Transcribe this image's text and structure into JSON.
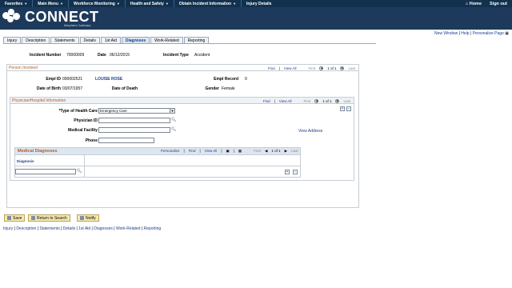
{
  "nav": {
    "items": [
      "Favorites",
      "Main Menu",
      "Workforce Monitoring",
      "Health and Safety",
      "Obtain Incident Information",
      "Injury Details"
    ],
    "home": "Home",
    "signout": "Sign out"
  },
  "brand": {
    "name": "CONNECT",
    "sub": "Maryland Judiciary"
  },
  "tools": {
    "new_window": "New Window",
    "help": "Help",
    "personalize": "Personalize Page"
  },
  "tabs": [
    "Injury",
    "Description",
    "Statements",
    "Details",
    "1st Aid",
    "Diagnoses",
    "Work-Related",
    "Reporting"
  ],
  "active_tab": "Diagnoses",
  "header": {
    "incident_number_label": "Incident Number",
    "incident_number": "70000009",
    "date_label": "Date",
    "date": "06/12/2015",
    "incident_type_label": "Incident Type",
    "incident_type": "Accident"
  },
  "person": {
    "title": "Person Involved",
    "pager": {
      "find": "Find",
      "view_all": "View All",
      "first": "First",
      "count": "1 of 1",
      "last": "Last"
    },
    "empl_id_label": "Empl ID",
    "empl_id": "000002521",
    "name": "LOUISE ROSE",
    "empl_record_label": "Empl Record",
    "empl_record": "0",
    "dob_label": "Date of Birth",
    "dob": "03/07/1957",
    "dod_label": "Date of Death",
    "gender_label": "Gender",
    "gender": "Female"
  },
  "physician": {
    "title": "Physician/Hospital Information",
    "pager": {
      "find": "Find",
      "view_all": "View All",
      "first": "First",
      "count": "1 of 1",
      "last": "Last"
    },
    "type_label": "*Type of Health Care",
    "type_value": "Emergency Care",
    "physician_id_label": "Physician ID",
    "medical_facility_label": "Medical Facility",
    "phone_label": "Phone",
    "view_address": "View Address"
  },
  "diagnoses": {
    "title": "Medical Diagnoses",
    "personalize": "Personalize",
    "find": "Find",
    "view_all": "View All",
    "first": "First",
    "count": "1 of 1",
    "last": "Last",
    "column": "Diagnosis"
  },
  "actions": {
    "save": "Save",
    "return": "Return to Search",
    "notify": "Notify"
  },
  "bottom_links": [
    "Injury",
    "Description",
    "Statements",
    "Details",
    "1st Aid",
    "Diagnoses",
    "Work-Related",
    "Reporting"
  ]
}
